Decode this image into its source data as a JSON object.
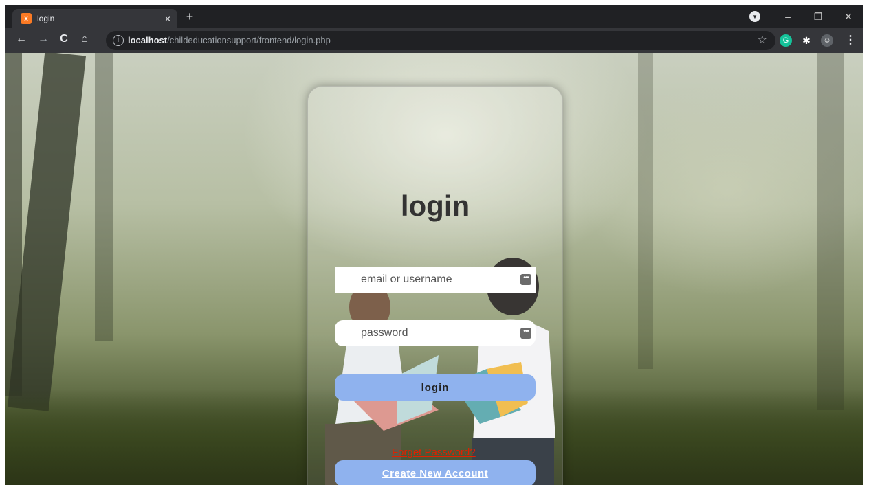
{
  "browser": {
    "tab_title": "login",
    "tab_close": "×",
    "new_tab": "+",
    "favicon_glyph": "x",
    "url_host": "localhost",
    "url_path": "/childeducationsupport/frontend/login.php",
    "nav": {
      "back": "←",
      "forward": "→",
      "reload": "C",
      "home": "⌂"
    },
    "star": "☆",
    "extensions": [
      {
        "name": "grammarly-icon",
        "glyph": "G",
        "color": "#15c39a"
      },
      {
        "name": "puzzle-icon",
        "glyph": "✱",
        "color": "#35363a"
      },
      {
        "name": "avatar-icon",
        "glyph": "☺",
        "color": "#5f6368"
      }
    ],
    "menu": "⋮",
    "window_controls": {
      "minimize": "–",
      "restore": "❐",
      "close": "✕"
    }
  },
  "login": {
    "title": "login",
    "email_placeholder": "email or username",
    "password_placeholder": "password",
    "login_button": "login",
    "forget_link": "Forget Password?",
    "create_button": "Create New Account",
    "field_icon_glyph": "•••"
  },
  "colors": {
    "button_bg": "#8fb2ee",
    "forget_link": "#e02000",
    "title": "#333333"
  }
}
